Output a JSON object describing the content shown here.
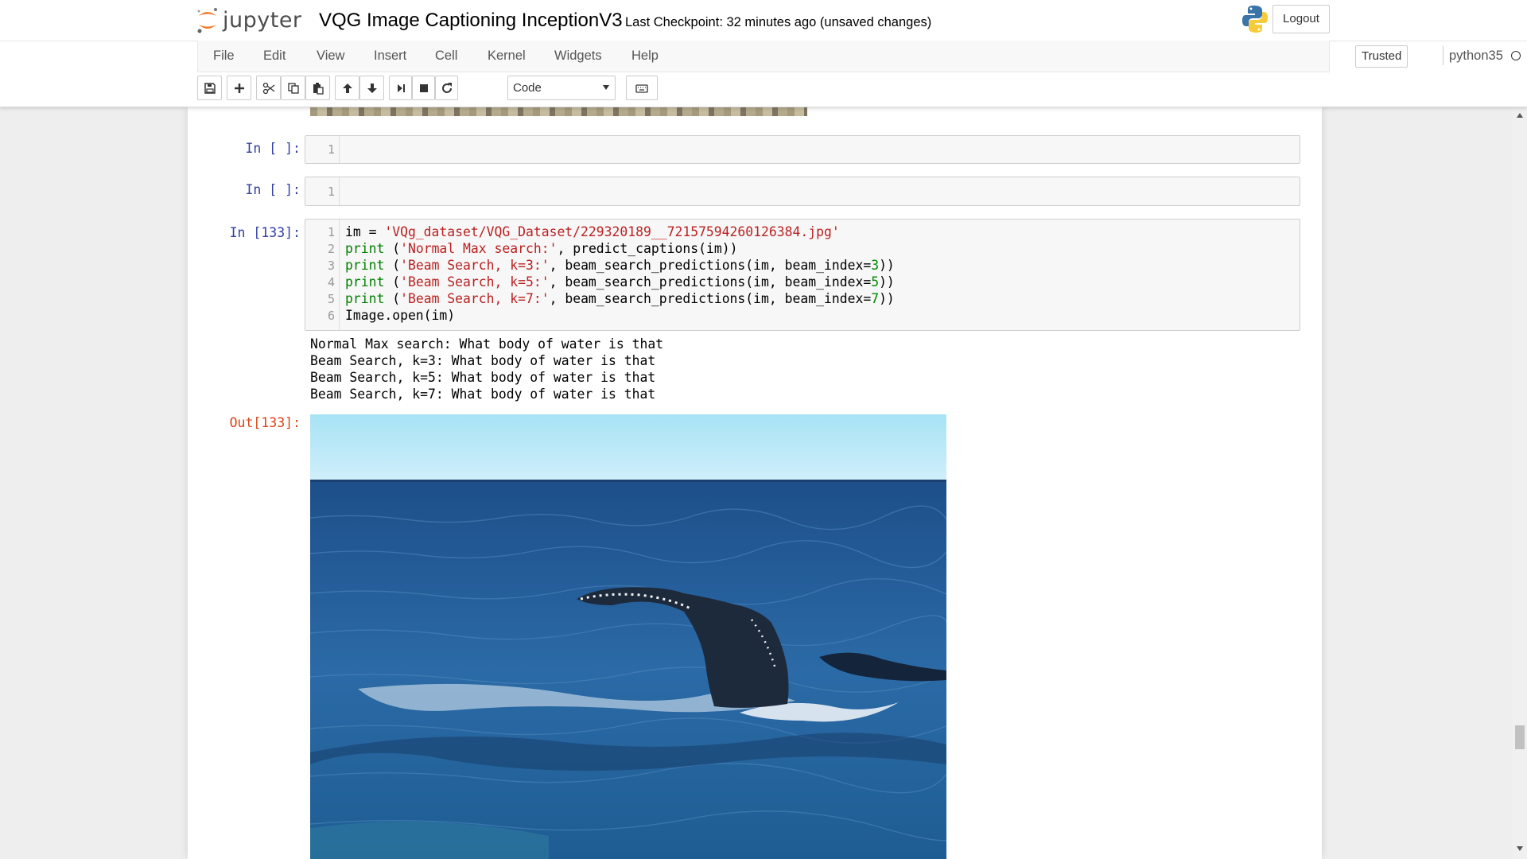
{
  "header": {
    "logo_text": "jupyter",
    "notebook_name": "VQG Image Captioning InceptionV3",
    "checkpoint_text": "Last Checkpoint: 32 minutes ago (unsaved changes)",
    "logout_label": "Logout"
  },
  "menubar": {
    "items": [
      "File",
      "Edit",
      "View",
      "Insert",
      "Cell",
      "Kernel",
      "Widgets",
      "Help"
    ],
    "trusted_label": "Trusted",
    "kernel_name": "python35"
  },
  "toolbar": {
    "cell_type": "Code",
    "icons": [
      "save-icon",
      "plus-icon",
      "cut-icon",
      "copy-icon",
      "paste-icon",
      "arrow-up-icon",
      "arrow-down-icon",
      "run-icon",
      "stop-icon",
      "restart-icon",
      "keyboard-icon"
    ]
  },
  "cells": [
    {
      "prompt": "In [ ]:",
      "line_numbers": [
        "1"
      ]
    },
    {
      "prompt": "In [ ]:",
      "line_numbers": [
        "1"
      ]
    },
    {
      "prompt": "In [133]:",
      "line_numbers": [
        "1",
        "2",
        "3",
        "4",
        "5",
        "6"
      ],
      "code": [
        {
          "a": "im = ",
          "s": "'VQg_dataset/VQG_Dataset/229320189__72157594260126384.jpg'"
        },
        {
          "k": "print",
          "a": " (",
          "s": "'Normal Max search:'",
          "b": ", predict_captions(im))"
        },
        {
          "k": "print",
          "a": " (",
          "s": "'Beam Search, k=3:'",
          "b": ", beam_search_predictions(im, beam_index=",
          "n": "3",
          "c": "))"
        },
        {
          "k": "print",
          "a": " (",
          "s": "'Beam Search, k=5:'",
          "b": ", beam_search_predictions(im, beam_index=",
          "n": "5",
          "c": "))"
        },
        {
          "k": "print",
          "a": " (",
          "s": "'Beam Search, k=7:'",
          "b": ", beam_search_predictions(im, beam_index=",
          "n": "7",
          "c": "))"
        },
        {
          "a": "Image.open(im)"
        }
      ],
      "stdout": [
        "Normal Max search: What body of water is that",
        "Beam Search, k=3: What body of water is that",
        "Beam Search, k=5: What body of water is that",
        "Beam Search, k=7: What body of water is that"
      ],
      "out_prompt": "Out[133]:"
    }
  ]
}
